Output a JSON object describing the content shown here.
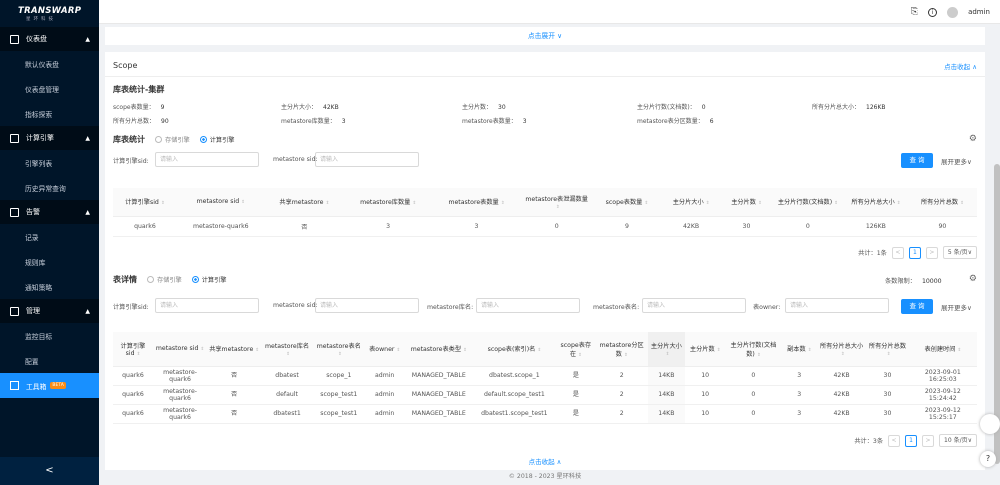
{
  "logo": {
    "main": "TRANSWARP",
    "sub": "星环科技"
  },
  "sidebar": {
    "g1": "仪表盘",
    "g1_items": [
      "默认仪表盘",
      "仪表盘管理",
      "指标探索"
    ],
    "g2": "计算引擎",
    "g2_items": [
      "引擎列表",
      "历史异常查询"
    ],
    "g3": "告警",
    "g3_items": [
      "记录",
      "规则库",
      "通知策略"
    ],
    "g4": "管理",
    "g4_items": [
      "监控目标",
      "配置"
    ],
    "g5": "工具箱",
    "g5_badge": "BETA",
    "collapse": "<"
  },
  "topbar": {
    "user": "admin",
    "info": "i"
  },
  "expand": "点击展开 ∨",
  "scope": {
    "title": "Scope",
    "collapse": "点击收起 ∧"
  },
  "stats": {
    "title": "库表统计-集群",
    "items": [
      {
        "label": "scope表数量：",
        "value": "9"
      },
      {
        "label": "主分片大小：",
        "value": "42KB"
      },
      {
        "label": "主分片数：",
        "value": "30"
      },
      {
        "label": "主分片行数(文档数)：",
        "value": "0"
      },
      {
        "label": "所有分片总大小：",
        "value": "126KB"
      },
      {
        "label": "所有分片总数：",
        "value": "90"
      },
      {
        "label": "metastore库数量：",
        "value": "3"
      },
      {
        "label": "metastore表数量：",
        "value": "3"
      },
      {
        "label": "metastore表分区数量：",
        "value": "6"
      }
    ]
  },
  "lib": {
    "title": "库表统计",
    "radio1": "存储引擎",
    "radio2": "计算引擎",
    "f1": "计算引擎sid:",
    "f1_ph": "请输入",
    "f2": "metastore sid:",
    "f2_ph": "请输入",
    "query": "查 询",
    "more": "展开更多∨",
    "headers": [
      "计算引擎sid",
      "metastore sid",
      "共享metastore",
      "metastore库数量",
      "metastore表数量",
      "metastore表泄漏数量",
      "scope表数量",
      "主分片大小",
      "主分片数",
      "主分片行数(文档数)",
      "所有分片总大小",
      "所有分片总数"
    ],
    "row": [
      "quark6",
      "metastore-quark6",
      "否",
      "3",
      "3",
      "0",
      "9",
      "42KB",
      "30",
      "0",
      "126KB",
      "90"
    ],
    "total": "共计：1条",
    "page": "1",
    "size": "5 条/页∨"
  },
  "detail": {
    "title": "表详情",
    "radio1": "存储引擎",
    "radio2": "计算引擎",
    "limit_label": "条数限制：",
    "limit": "10000",
    "f1": "计算引擎sid:",
    "f2": "metastore sid:",
    "f3": "metastore库名:",
    "f4": "metastore表名:",
    "f5": "表owner:",
    "ph": "请输入",
    "query": "查 询",
    "more": "展开更多∨",
    "headers": [
      "计算引擎sid",
      "metastore sid",
      "共享metastore",
      "metastore库名",
      "metastore表名",
      "表owner",
      "metastore表类型",
      "scope表(索引)名",
      "scope表存在",
      "metastore分区数",
      "主分片大小",
      "主分片数",
      "主分片行数(文档数)",
      "副本数",
      "所有分片总大小",
      "所有分片总数",
      "表创建时间"
    ],
    "rows": [
      [
        "quark6",
        "metastore-quark6",
        "否",
        "dbatest",
        "scope_1",
        "admin",
        "MANAGED_TABLE",
        "dbatest.scope_1",
        "是",
        "2",
        "14KB",
        "10",
        "0",
        "3",
        "42KB",
        "30",
        "2023-09-01 16:25:03"
      ],
      [
        "quark6",
        "metastore-quark6",
        "否",
        "default",
        "scope_test1",
        "admin",
        "MANAGED_TABLE",
        "default.scope_test1",
        "是",
        "2",
        "14KB",
        "10",
        "0",
        "3",
        "42KB",
        "30",
        "2023-09-12 15:24:42"
      ],
      [
        "quark6",
        "metastore-quark6",
        "否",
        "dbatest1",
        "scope_test1",
        "admin",
        "MANAGED_TABLE",
        "dbatest1.scope_test1",
        "是",
        "2",
        "14KB",
        "10",
        "0",
        "3",
        "42KB",
        "30",
        "2023-09-12 15:25:17"
      ]
    ],
    "total": "共计：3条",
    "page": "1",
    "size": "10 条/页∨"
  },
  "collapse_bottom": "点击收起 ∧",
  "footer": "© 2018 - 2023 星环科技"
}
